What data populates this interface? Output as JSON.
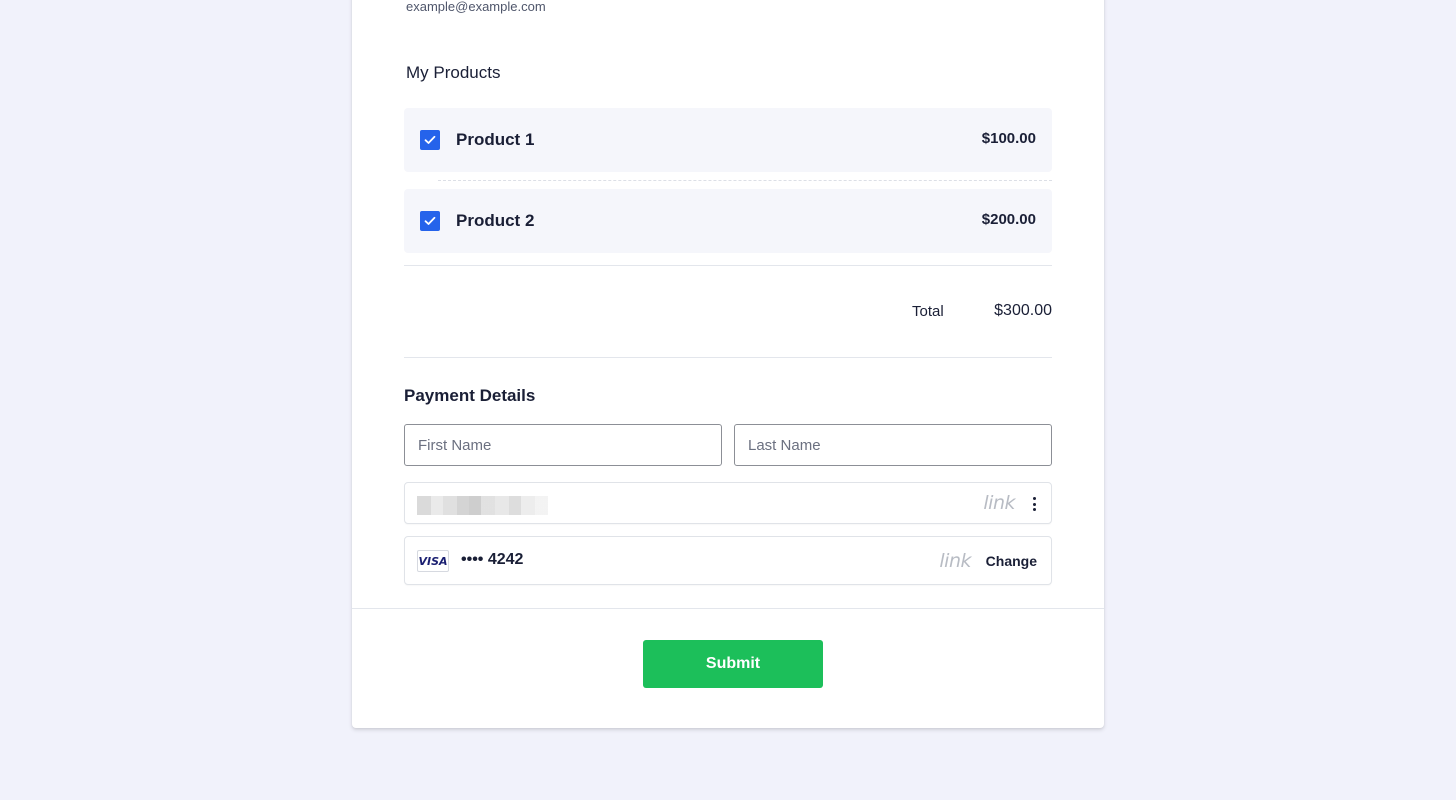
{
  "account": {
    "email": "example@example.com"
  },
  "products": {
    "title": "My Products",
    "items": [
      {
        "name": "Product 1",
        "price": "$100.00",
        "checked": true
      },
      {
        "name": "Product 2",
        "price": "$200.00",
        "checked": true
      }
    ],
    "total_label": "Total",
    "total_value": "$300.00"
  },
  "payment": {
    "title": "Payment Details",
    "first_name_placeholder": "First Name",
    "last_name_placeholder": "Last Name",
    "link_logo": "link",
    "card_brand": "VISA",
    "card_masked": "•••• 4242",
    "change_label": "Change"
  },
  "submit_label": "Submit",
  "colors": {
    "background": "#f1f2fb",
    "checkbox": "#2563eb",
    "submit": "#1cbf5a",
    "product_row": "#f5f6fb"
  },
  "icons": {
    "checkbox": "check-icon",
    "menu": "kebab-menu-icon",
    "card": "visa-icon"
  }
}
